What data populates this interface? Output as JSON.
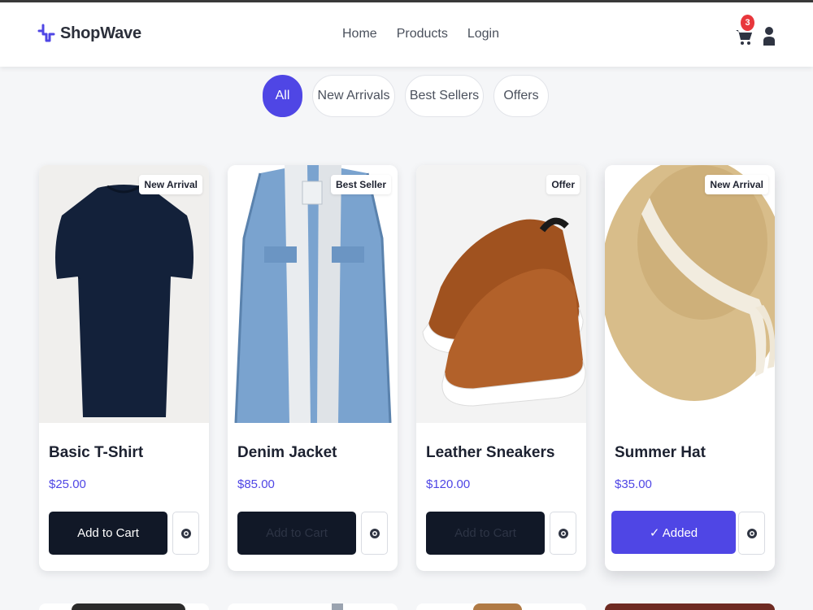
{
  "brand": {
    "name": "ShopWave",
    "accent": "#4f46e5"
  },
  "nav": {
    "links": [
      "Home",
      "Products",
      "Login"
    ]
  },
  "cart": {
    "count": "3"
  },
  "filters": {
    "items": [
      "All",
      "New Arrivals",
      "Best Sellers",
      "Offers"
    ],
    "active": "All"
  },
  "products": [
    {
      "name": "Basic T-Shirt",
      "price": "$25.00",
      "badge": "New Arrival",
      "button": "Add to Cart",
      "image": "navy-tshirt"
    },
    {
      "name": "Denim Jacket",
      "price": "$85.00",
      "badge": "Best Seller",
      "button": "Add to Cart",
      "image": "denim-jacket"
    },
    {
      "name": "Leather Sneakers",
      "price": "$120.00",
      "badge": "Offer",
      "button": "Add to Cart",
      "image": "brown-sneakers"
    },
    {
      "name": "Summer Hat",
      "price": "$35.00",
      "badge": "New Arrival",
      "button": "✓ Added",
      "image": "straw-hat"
    }
  ],
  "colors": {
    "dark_button": "#111827",
    "accent": "#4f46e5",
    "badge_red": "#e8373c",
    "background": "#f5f6f8"
  }
}
